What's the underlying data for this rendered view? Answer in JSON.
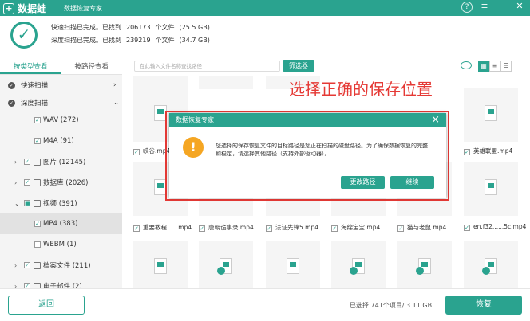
{
  "titlebar": {
    "logo_mark": "+",
    "app_name": "数据蛙",
    "subtitle": "数据恢复专家"
  },
  "scan": {
    "quick_label": "快速扫描已完成。已找到",
    "quick_count": "206173",
    "quick_unit": "个文件",
    "quick_size": "(25.5 GB)",
    "deep_label": "深度扫描已完成。已找到",
    "deep_count": "239219",
    "deep_unit": "个文件",
    "deep_size": "(34.7 GB)"
  },
  "tabs": [
    "按类型查看",
    "按路径查看"
  ],
  "sidebar": {
    "quick": "快速扫描",
    "deep": "深度扫描",
    "wav": "WAV (272)",
    "m4a": "M4A (91)",
    "images": "图片 (12145)",
    "database": "数据库 (2026)",
    "video": "视频 (391)",
    "mp4": "MP4 (383)",
    "webm": "WEBM (1)",
    "docs": "档案文件 (211)",
    "email": "电子邮件 (2)"
  },
  "toolbar": {
    "search_placeholder": "在此输入文件名称查找路径",
    "filter_label": "筛选器"
  },
  "annotation": "选择正确的保存位置",
  "files_row1": [
    {
      "name": "峡谷.mp4"
    },
    {
      "name": "英雄联盟.mp4"
    }
  ],
  "files_row2": [
    {
      "name": "重要教程......mp4"
    },
    {
      "name": "唐朝诡事录.mp4"
    },
    {
      "name": "法证先锋5.mp4"
    },
    {
      "name": "海绵宝宝.mp4"
    },
    {
      "name": "猫与老鼠.mp4"
    },
    {
      "name": "en.f32......5c.mp4"
    }
  ],
  "dialog": {
    "title": "数据恢复专家",
    "msg_line1": "您选择的保存恢复文件的目标路径是您正在扫描的磁盘路径。为了确保数据恢复的完整",
    "msg_line2": "和稳定，请选择其他路径（支持外部驱动器）。",
    "change_path": "更改路径",
    "continue": "继续"
  },
  "footer": {
    "back": "返回",
    "selected": "已选择 741个项目/ 3.11 GB",
    "recover": "恢复"
  },
  "colors": {
    "accent": "#2aa38f",
    "annotation": "#e53935",
    "warning": "#f5a623"
  }
}
